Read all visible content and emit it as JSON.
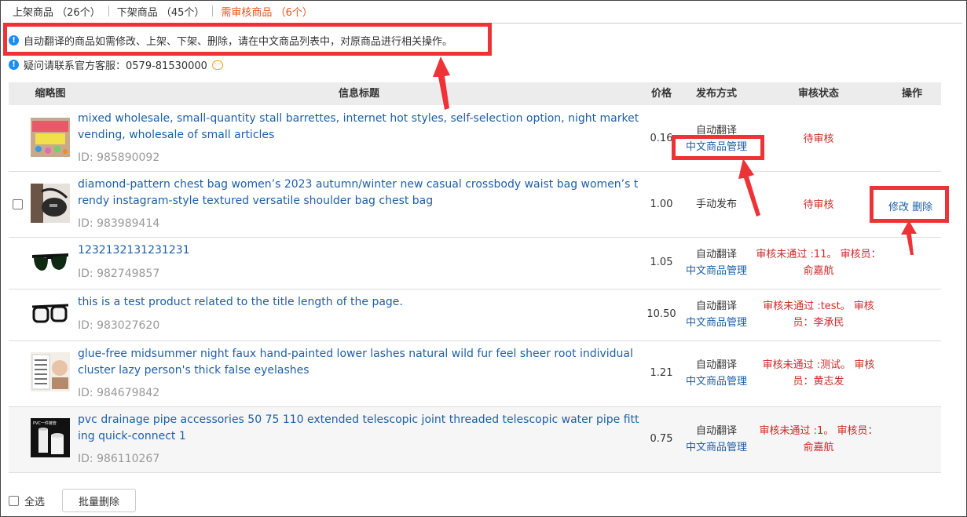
{
  "tabs": [
    {
      "label": "上架商品",
      "count": "（26个）"
    },
    {
      "label": "下架商品",
      "count": "（45个）"
    },
    {
      "label": "需审核商品",
      "count": "（6个）"
    }
  ],
  "notices": {
    "auto_translate": "自动翻译的商品如需修改、上架、下架、删除，请在中文商品列表中，对原商品进行相关操作。",
    "contact": "疑问请联系官方客服：0579-81530000"
  },
  "table": {
    "headers": {
      "thumb": "缩略图",
      "title": "信息标题",
      "price": "价格",
      "publish": "发布方式",
      "status": "审核状态",
      "ops": "操作"
    },
    "rows": [
      {
        "title": "mixed wholesale, small-quantity stall barrettes, internet hot styles, self-selection option, night market vending, wholesale of small articles",
        "id": "ID: 985890092",
        "price": "0.16",
        "publish": "自动翻译",
        "publish_link": "中文商品管理",
        "status": "待审核",
        "thumb": "hair-accessories-image"
      },
      {
        "title": "diamond-pattern chest bag women’s 2023 autumn/winter new casual crossbody waist bag women’s trendy instagram-style textured versatile shoulder bag chest bag",
        "id": "ID: 983989414",
        "price": "1.00",
        "publish": "手动发布",
        "status": "待审核",
        "edit": "修改",
        "delete": "删除",
        "thumb": "chest-bag-image"
      },
      {
        "title": "1232132131231231",
        "id": "ID: 982749857",
        "price": "1.05",
        "publish": "自动翻译",
        "publish_link": "中文商品管理",
        "status": "审核未通过 :11。 审核员：俞嘉航",
        "thumb": "sunglasses-image"
      },
      {
        "title": "this is a test product related to the title length of the page.",
        "id": "ID: 983027620",
        "price": "10.50",
        "publish": "自动翻译",
        "publish_link": "中文商品管理",
        "status": "审核未通过 :test。 审核员：李承民",
        "thumb": "glasses-image"
      },
      {
        "title": "glue-free midsummer night faux hand-painted lower lashes natural wild fur feel sheer root individual cluster lazy person's thick false eyelashes",
        "id": "ID: 984679842",
        "price": "1.21",
        "publish": "自动翻译",
        "publish_link": "中文商品管理",
        "status": "审核未通过 :测试。 审核员：黄志发",
        "thumb": "eyelashes-image"
      },
      {
        "title": "pvc drainage pipe accessories 50 75 110 extended telescopic joint threaded telescopic water pipe fitting quick-connect 1",
        "id": "ID: 986110267",
        "price": "0.75",
        "publish": "自动翻译",
        "publish_link": "中文商品管理",
        "status": "审核未通过 :1。 审核员：俞嘉航",
        "thumb": "pvc-pipe-image",
        "thumb_text": "PVC一件链管"
      }
    ]
  },
  "footer": {
    "select_all": "全选",
    "batch_delete": "批量删除"
  },
  "colors": {
    "accent": "#e8521c",
    "link": "#1d5fa6",
    "status_red": "#cc2a2a",
    "highlight": "#ee3338",
    "info_blue": "#1a8ef2"
  }
}
